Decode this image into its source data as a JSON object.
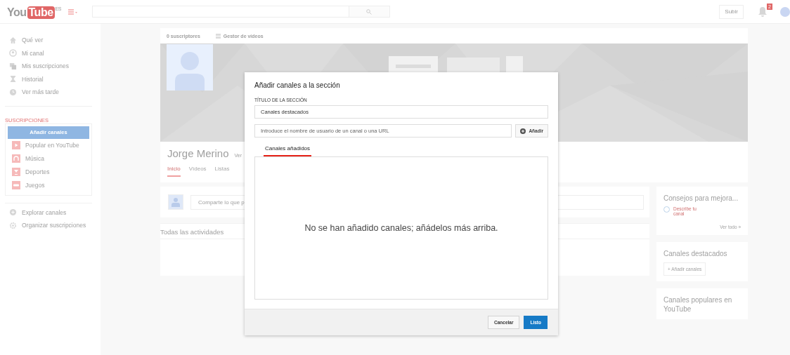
{
  "header": {
    "logo": {
      "left": "You",
      "right": "Tube",
      "region": "ES"
    },
    "upload_button": "Subir",
    "notification_count": "2"
  },
  "sidebar": {
    "items": [
      {
        "label": "Qué ver"
      },
      {
        "label": "Mi canal"
      },
      {
        "label": "Mis suscripciones"
      },
      {
        "label": "Historial"
      },
      {
        "label": "Ver más tarde"
      }
    ],
    "subscriptions_heading": "SUSCRIPCIONES",
    "add_channels_button": "Añadir canales",
    "subscriptions": [
      {
        "label": "Popular en YouTube"
      },
      {
        "label": "Música"
      },
      {
        "label": "Deportes"
      },
      {
        "label": "Juegos"
      }
    ],
    "footer_items": [
      {
        "label": "Explorar canales"
      },
      {
        "label": "Organizar suscripciones"
      }
    ]
  },
  "channel": {
    "subscribers": "0 suscriptores",
    "video_manager": "Gestor de vídeos",
    "name": "Jorge Merino",
    "name_link": "Ver",
    "tabs": [
      {
        "label": "Inicio",
        "selected": true
      },
      {
        "label": "Vídeos",
        "selected": false
      },
      {
        "label": "Listas",
        "selected": false
      }
    ],
    "share_placeholder": "Comparte lo que p",
    "activity_heading": "Todas las actividades"
  },
  "right_cards": [
    {
      "kind": "tips",
      "title": "Consejos para mejora...",
      "task": "Describe tu canal",
      "task_done": false,
      "link": "Ver todo »"
    },
    {
      "kind": "featured",
      "title": "Canales destacados",
      "button": "+ Añadir canales"
    },
    {
      "kind": "popular",
      "title": "Canales populares en YouTube"
    }
  ],
  "dialog": {
    "title": "Añadir canales a la sección",
    "section_label": "TÍTULO DE LA SECCIÓN",
    "section_title_value": "Canales destacados",
    "channel_input_placeholder": "Introduce el nombre de usuario de un canal o una URL",
    "add_button": "Añadir",
    "tabs": [
      {
        "label": "Canales añadidos",
        "selected": true
      }
    ],
    "empty_message": "No se han añadido canales; añádelos más arriba.",
    "buttons": [
      {
        "label": "Cancelar",
        "kind": "secondary"
      },
      {
        "label": "Listo",
        "kind": "primary"
      }
    ]
  }
}
